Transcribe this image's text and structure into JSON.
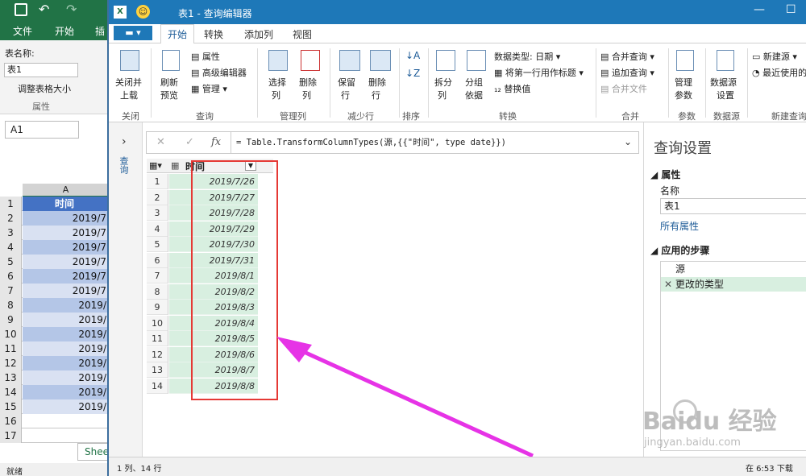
{
  "excel": {
    "menu": {
      "file": "文件",
      "home": "开始",
      "insert": "插"
    },
    "ribbon": {
      "table_name_label": "表名称:",
      "table_name_value": "表1",
      "resize_table": "调整表格大小",
      "properties_group": "属性"
    },
    "name_box": "A1",
    "column_header": "A",
    "header_cell": "时间",
    "row_numbers": [
      "1",
      "2",
      "3",
      "4",
      "5",
      "6",
      "7",
      "8",
      "9",
      "10",
      "11",
      "12",
      "13",
      "14",
      "15",
      "16",
      "17"
    ],
    "cells": [
      "时间",
      "2019/7",
      "2019/7",
      "2019/7",
      "2019/7",
      "2019/7",
      "2019/7",
      "2019/",
      "2019/",
      "2019/",
      "2019/",
      "2019/",
      "2019/",
      "2019/",
      "2019/",
      "",
      ""
    ],
    "sheet_tab": "Shee",
    "status": "就绪"
  },
  "pq": {
    "title": "表1 - 查询编辑器",
    "tabs": [
      "开始",
      "转换",
      "添加列",
      "视图"
    ],
    "file_button": "▾",
    "ribbon": {
      "close_load": [
        "关闭并",
        "上载"
      ],
      "refresh_preview": [
        "刷新",
        "预览"
      ],
      "properties": "属性",
      "advanced_editor": "高级编辑器",
      "manage": "管理",
      "choose_columns": [
        "选择",
        "列"
      ],
      "remove_columns": [
        "删除",
        "列"
      ],
      "keep_rows": [
        "保留",
        "行"
      ],
      "remove_rows": [
        "删除",
        "行"
      ],
      "split_column": [
        "拆分",
        "列"
      ],
      "group_by": [
        "分组",
        "依据"
      ],
      "data_type": "数据类型: 日期",
      "use_first_row": "将第一行用作标题",
      "replace_values": "替换值",
      "merge_queries": "合并查询",
      "append_queries": "追加查询",
      "combine_files": "合并文件",
      "manage_params": [
        "管理",
        "参数"
      ],
      "data_source_settings": [
        "数据源",
        "设置"
      ],
      "new_source": "新建源",
      "recent_sources": "最近使用的",
      "groups": [
        "关闭",
        "查询",
        "管理列",
        "减少行",
        "排序",
        "转换",
        "合并",
        "参数",
        "数据源",
        "新建查询"
      ]
    },
    "left_pane_label": "查询",
    "formula": "= Table.TransformColumnTypes(源,{{\"时间\", type date}})",
    "column_header": "时间",
    "row_numbers": [
      "1",
      "2",
      "3",
      "4",
      "5",
      "6",
      "7",
      "8",
      "9",
      "10",
      "11",
      "12",
      "13",
      "14"
    ],
    "rows": [
      "2019/7/26",
      "2019/7/27",
      "2019/7/28",
      "2019/7/29",
      "2019/7/30",
      "2019/7/31",
      "2019/8/1",
      "2019/8/2",
      "2019/8/3",
      "2019/8/4",
      "2019/8/5",
      "2019/8/6",
      "2019/8/7",
      "2019/8/8"
    ],
    "query_settings": {
      "title": "查询设置",
      "properties_header": "属性",
      "name_label": "名称",
      "name_value": "表1",
      "all_properties": "所有属性",
      "applied_steps_header": "应用的步骤",
      "steps": [
        "源",
        "更改的类型"
      ]
    },
    "status_left": "1 列、14 行",
    "status_right": "在 6:53 下载"
  },
  "watermark": {
    "brand": "Baidu 经验",
    "url": "jingyan.baidu.com"
  },
  "colors": {
    "excel_green": "#217346",
    "pq_blue": "#1e78b8",
    "highlight_red": "#e53935",
    "arrow_magenta": "#e633e6",
    "cell_green": "#d8efe0"
  }
}
